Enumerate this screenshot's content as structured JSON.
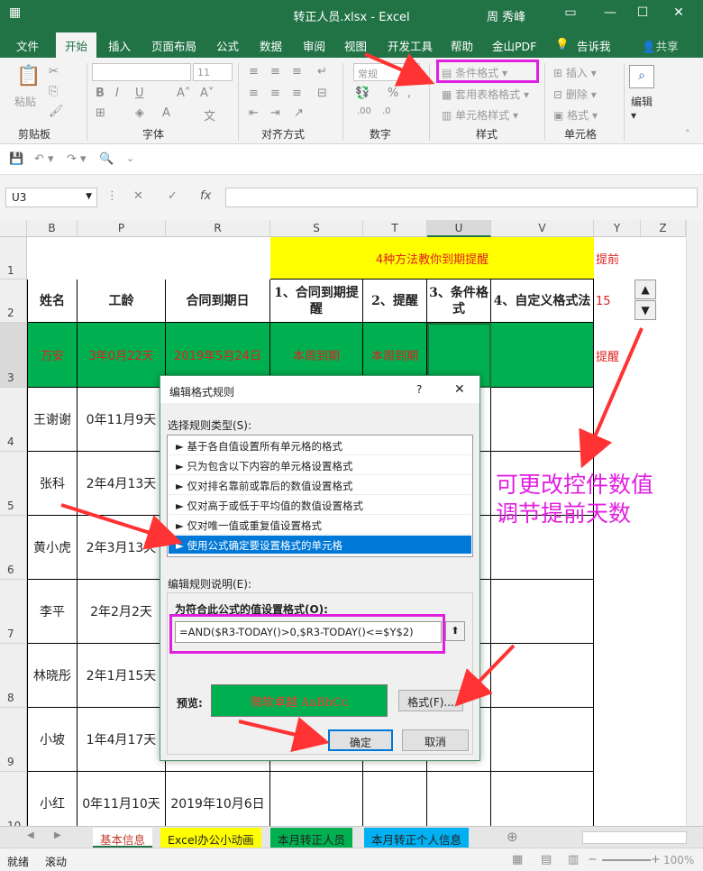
{
  "window": {
    "file_title": "转正人员.xlsx  -  Excel",
    "user": "周 秀峰"
  },
  "ribbon": {
    "tabs": [
      "文件",
      "开始",
      "插入",
      "页面布局",
      "公式",
      "数据",
      "审阅",
      "视图",
      "开发工具",
      "帮助",
      "金山PDF",
      "告诉我",
      "共享"
    ],
    "groups": {
      "clipboard": "剪贴板",
      "font": "字体",
      "alignment": "对齐方式",
      "number": "数字",
      "styles": "样式",
      "cells": "单元格",
      "editing": "编辑"
    },
    "paste": "粘贴",
    "font_size": "11",
    "number_format": "常规",
    "conditional_format": "条件格式",
    "table_format": "套用表格格式",
    "cell_style": "单元格样式",
    "insert": "插入",
    "delete": "删除",
    "format": "格式"
  },
  "formula_bar": {
    "name_box": "U3",
    "fx": "fx"
  },
  "columns": [
    "B",
    "P",
    "R",
    "S",
    "T",
    "U",
    "V",
    "Y",
    "Z"
  ],
  "rows": [
    "1",
    "2",
    "3",
    "4",
    "5",
    "6",
    "7",
    "8",
    "9",
    "10"
  ],
  "sheet": {
    "title_banner": "4种方法教你到期提醒",
    "y1": "提前",
    "y2": "15",
    "y3": "提醒",
    "headers": {
      "name": "姓名",
      "tenure": "工龄",
      "contract": "合同到期日",
      "m1": "1、合同到期提醒",
      "m2": "2、提醒",
      "m3": "3、条件格式",
      "m4": "4、自定义格式法"
    },
    "row3": {
      "name": "万安",
      "tenure": "3年0月22天",
      "contract": "2019年5月24日",
      "m1": "本周到期",
      "m2": "本周到期"
    },
    "people": [
      {
        "name": "王谢谢",
        "tenure": "0年11月9天"
      },
      {
        "name": "张科",
        "tenure": "2年4月13天"
      },
      {
        "name": "黄小虎",
        "tenure": "2年3月13天"
      },
      {
        "name": "李平",
        "tenure": "2年2月2天"
      },
      {
        "name": "林晓彤",
        "tenure": "2年1月15天"
      },
      {
        "name": "小坡",
        "tenure": "1年4月17天"
      },
      {
        "name": "小红",
        "tenure": "0年11月10天",
        "contract": "2019年10月6日"
      }
    ]
  },
  "dialog": {
    "title": "编辑格式规则",
    "help": "?",
    "rule_type_label": "选择规则类型(S):",
    "rule_types": [
      "► 基于各自值设置所有单元格的格式",
      "► 只为包含以下内容的单元格设置格式",
      "► 仅对排名靠前或靠后的数值设置格式",
      "► 仅对高于或低于平均值的数值设置格式",
      "► 仅对唯一值或重复值设置格式",
      "► 使用公式确定要设置格式的单元格"
    ],
    "selected_index": 5,
    "edit_desc_label": "编辑规则说明(E):",
    "formula_label": "为符合此公式的值设置格式(O):",
    "formula": "=AND($R3-TODAY()>0,$R3-TODAY()<=$Y$2)",
    "preview_label": "预览:",
    "preview_text": "微软卓越  AaBbCc",
    "format_button": "格式(F)...",
    "ok_button": "确定",
    "cancel_button": "取消"
  },
  "annotation": {
    "line1": "可更改控件数值",
    "line2": "调节提前天数"
  },
  "sheet_tabs": [
    "基本信息",
    "Excel办公小动画",
    "本月转正人员",
    "本月转正个人信息"
  ],
  "status": {
    "ready": "就绪",
    "scroll": "滚动",
    "zoom": "100%"
  },
  "colors": {
    "excel_green": "#217346",
    "highlight_green": "#00b050",
    "banner_yellow": "#ffff00",
    "alert_red": "#e02020",
    "annotation_magenta": "#e020e0",
    "arrow_red": "#ff3333",
    "selection_blue": "#0078d7"
  }
}
